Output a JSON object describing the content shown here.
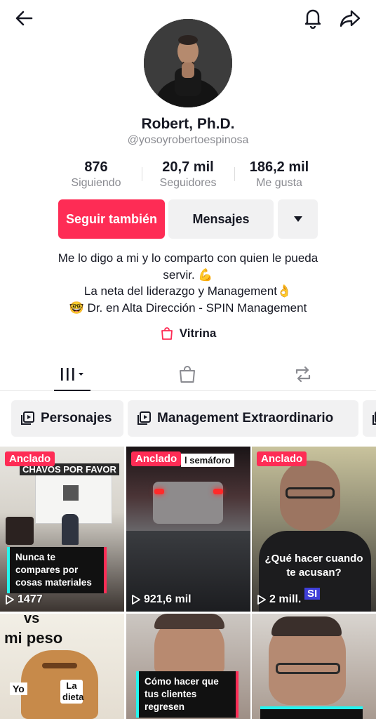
{
  "header": {
    "back_icon": "arrow-left-icon",
    "bell_icon": "bell-icon",
    "share_icon": "share-arrow-icon"
  },
  "profile": {
    "name": "Robert, Ph.D.",
    "handle": "@yosoyrobertoespinosa"
  },
  "stats": {
    "following_value": "876",
    "following_label": "Siguiendo",
    "followers_value": "20,7 mil",
    "followers_label": "Seguidores",
    "likes_value": "186,2 mil",
    "likes_label": "Me gusta"
  },
  "actions": {
    "follow_label": "Seguir también",
    "message_label": "Mensajes",
    "follow_color": "#fe2c55"
  },
  "bio": {
    "line1": "Me lo digo a mi y lo comparto con quien le pueda",
    "line2": "servir. 💪",
    "line3": "La neta del liderazgo y Management👌",
    "line4": "🤓 Dr. en Alta Dirección - SPIN Management"
  },
  "showcase": {
    "label": "Vitrina"
  },
  "playlists": [
    {
      "label": "Personajes"
    },
    {
      "label": "Management Extraordinario"
    }
  ],
  "videos": [
    {
      "pinned": "Anclado",
      "title_overlay": "CHAVOS POR FAVOR",
      "caption": "Nunca te compares por cosas materiales",
      "views": "1477"
    },
    {
      "pinned": "Anclado",
      "title_overlay": "l semáforo",
      "views": "921,6 mil"
    },
    {
      "pinned": "Anclado",
      "caption": "¿Qué hacer cuando te acusan?",
      "badge": "SI",
      "views": "2 mill."
    },
    {
      "overlay_top": "vs",
      "overlay_mid": "mi peso",
      "label_a": "Yo",
      "label_b": "La dieta"
    },
    {
      "caption": "Cómo hacer que tus clientes regresen"
    },
    {}
  ]
}
